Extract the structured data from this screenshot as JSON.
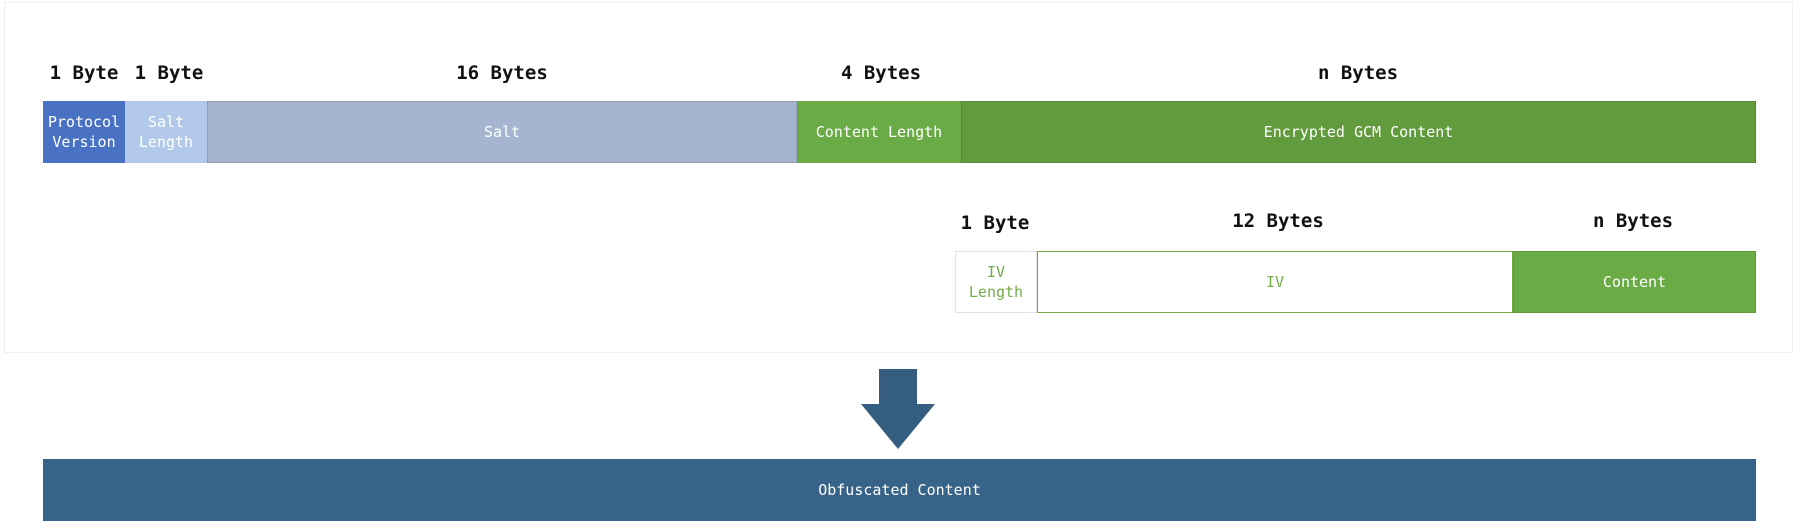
{
  "header_row": {
    "sizes": [
      "1 Byte",
      "1 Byte",
      "16 Bytes",
      "4 Bytes",
      "n Bytes"
    ],
    "fields": [
      "Protocol\nVersion",
      "Salt\nLength",
      "Salt",
      "Content Length",
      "Encrypted GCM Content"
    ]
  },
  "gcm_row": {
    "sizes": [
      "1 Byte",
      "12 Bytes",
      "n Bytes"
    ],
    "fields": [
      "IV\nLength",
      "IV",
      "Content"
    ]
  },
  "output": {
    "label": "Obfuscated Content"
  },
  "colors": {
    "protocol_version": "#4a72c4",
    "salt_length": "#b3c9ea",
    "salt": "#a5b5cf",
    "content_length": "#6aab46",
    "encrypted_content": "#629a3e",
    "iv_text": "#70ad47",
    "obfuscated": "#386389",
    "arrow": "#355d80"
  }
}
